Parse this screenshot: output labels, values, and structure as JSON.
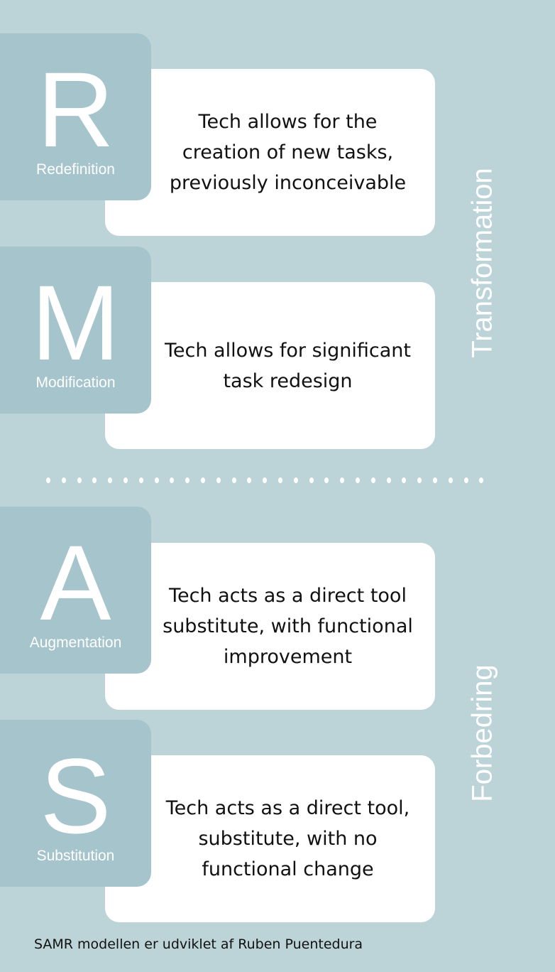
{
  "levels": [
    {
      "letter": "R",
      "name": "Redefinition",
      "description": "Tech allows for the\ncreation of new tasks,\npreviously inconceivable"
    },
    {
      "letter": "M",
      "name": "Modification",
      "description": "Tech allows for significant\ntask redesign"
    },
    {
      "letter": "A",
      "name": "Augmentation",
      "description": "Tech acts as a direct tool\nsubstitute, with functional\nimprovement"
    },
    {
      "letter": "S",
      "name": "Substitution",
      "description": "Tech acts as a direct tool,\nsubstitute, with no\nfunctional change"
    }
  ],
  "groups": {
    "upper": "Transformation",
    "lower": "Forbedring"
  },
  "footer": "SAMR modellen er udviklet af Ruben Puentedura",
  "colors": {
    "background": "#bcd4d8",
    "letter_box": "#a6c4cc",
    "card": "#ffffff"
  }
}
